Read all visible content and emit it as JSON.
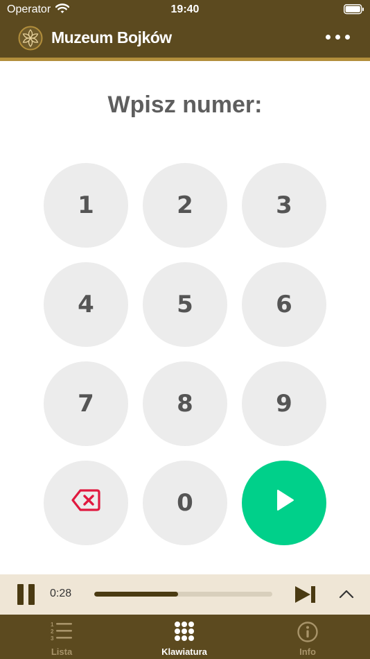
{
  "status_bar": {
    "carrier": "Operator",
    "time": "19:40"
  },
  "header": {
    "title": "Muzeum Bojków",
    "logo_icon": "museum-rosette-icon",
    "menu_icon": "more-dots-icon"
  },
  "keypad": {
    "prompt": "Wpisz numer:",
    "keys": [
      "1",
      "2",
      "3",
      "4",
      "5",
      "6",
      "7",
      "8",
      "9",
      "0"
    ],
    "delete_icon": "backspace-icon",
    "play_icon": "play-icon"
  },
  "player": {
    "elapsed": "0:28",
    "progress": 0.47,
    "pause_icon": "pause-icon",
    "next_icon": "skip-next-icon",
    "expand_icon": "chevron-up-icon"
  },
  "tabs": [
    {
      "label": "Lista",
      "icon": "numbered-list-icon",
      "active": false
    },
    {
      "label": "Klawiatura",
      "icon": "keypad-icon",
      "active": true
    },
    {
      "label": "Info",
      "icon": "info-icon",
      "active": false
    }
  ],
  "colors": {
    "brand_brown": "#5c4a1f",
    "gold": "#b38f3c",
    "play_green": "#00d08a",
    "delete_red": "#e0193f",
    "player_bg": "#efe6d6"
  }
}
